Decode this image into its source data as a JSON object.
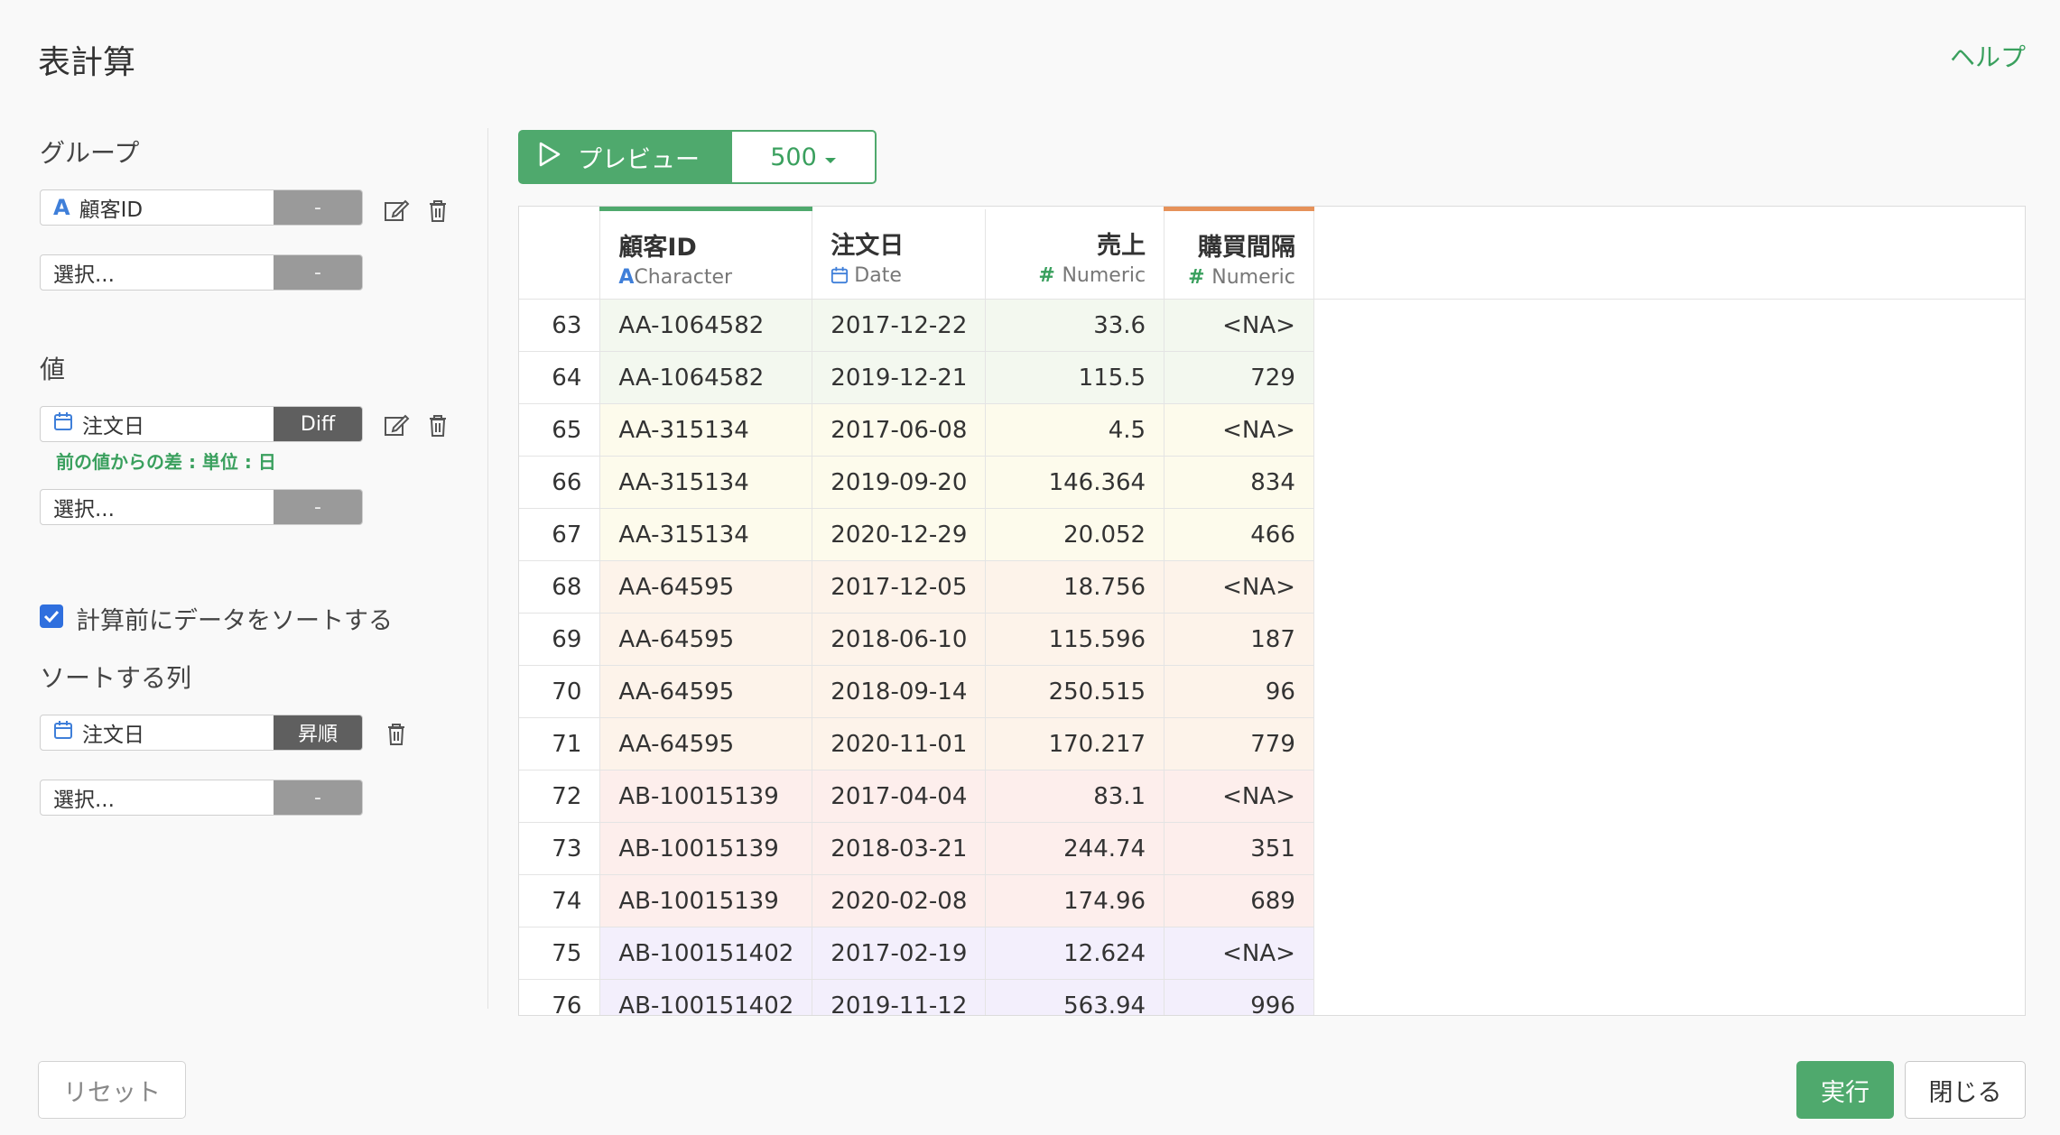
{
  "dialog": {
    "title": "表計算",
    "help_label": "ヘルプ"
  },
  "group": {
    "label": "グループ",
    "fields": [
      {
        "icon": "character-icon",
        "value": "顧客ID",
        "button": "-"
      },
      {
        "icon": "",
        "value": "選択...",
        "button": "-"
      }
    ]
  },
  "value_section": {
    "label": "値",
    "fields": [
      {
        "icon": "calendar-icon",
        "value": "注文日",
        "button": "Diff"
      },
      {
        "icon": "",
        "value": "選択...",
        "button": "-"
      }
    ],
    "hint": "前の値からの差 : 単位 : 日"
  },
  "sort": {
    "checkbox_label": "計算前にデータをソートする",
    "checked": true,
    "label": "ソートする列",
    "fields": [
      {
        "icon": "calendar-icon",
        "value": "注文日",
        "button": "昇順"
      },
      {
        "icon": "",
        "value": "選択...",
        "button": "-"
      }
    ]
  },
  "preview": {
    "button_label": "プレビュー",
    "rows": "500"
  },
  "table": {
    "columns": [
      {
        "name": "顧客ID",
        "type": "Character",
        "type_icon": "A"
      },
      {
        "name": "注文日",
        "type": "Date",
        "type_icon": "calendar"
      },
      {
        "name": "売上",
        "type": "Numeric",
        "type_icon": "#"
      },
      {
        "name": "購買間隔",
        "type": "Numeric",
        "type_icon": "#"
      }
    ],
    "rows": [
      {
        "idx": "63",
        "id": "AA-1064582",
        "date": "2017-12-22",
        "sales": "33.6",
        "interval": "<NA>",
        "color": "#f3f8ef"
      },
      {
        "idx": "64",
        "id": "AA-1064582",
        "date": "2019-12-21",
        "sales": "115.5",
        "interval": "729",
        "color": "#f3f8ef"
      },
      {
        "idx": "65",
        "id": "AA-315134",
        "date": "2017-06-08",
        "sales": "4.5",
        "interval": "<NA>",
        "color": "#fdfbec"
      },
      {
        "idx": "66",
        "id": "AA-315134",
        "date": "2019-09-20",
        "sales": "146.364",
        "interval": "834",
        "color": "#fdfbec"
      },
      {
        "idx": "67",
        "id": "AA-315134",
        "date": "2020-12-29",
        "sales": "20.052",
        "interval": "466",
        "color": "#fdfbec"
      },
      {
        "idx": "68",
        "id": "AA-64595",
        "date": "2017-12-05",
        "sales": "18.756",
        "interval": "<NA>",
        "color": "#fdf3ea"
      },
      {
        "idx": "69",
        "id": "AA-64595",
        "date": "2018-06-10",
        "sales": "115.596",
        "interval": "187",
        "color": "#fdf3ea"
      },
      {
        "idx": "70",
        "id": "AA-64595",
        "date": "2018-09-14",
        "sales": "250.515",
        "interval": "96",
        "color": "#fdf3ea"
      },
      {
        "idx": "71",
        "id": "AA-64595",
        "date": "2020-11-01",
        "sales": "170.217",
        "interval": "779",
        "color": "#fdf3ea"
      },
      {
        "idx": "72",
        "id": "AB-10015139",
        "date": "2017-04-04",
        "sales": "83.1",
        "interval": "<NA>",
        "color": "#fdeeec"
      },
      {
        "idx": "73",
        "id": "AB-10015139",
        "date": "2018-03-21",
        "sales": "244.74",
        "interval": "351",
        "color": "#fdeeec"
      },
      {
        "idx": "74",
        "id": "AB-10015139",
        "date": "2020-02-08",
        "sales": "174.96",
        "interval": "689",
        "color": "#fdeeec"
      },
      {
        "idx": "75",
        "id": "AB-100151402",
        "date": "2017-02-19",
        "sales": "12.624",
        "interval": "<NA>",
        "color": "#f3effc"
      },
      {
        "idx": "76",
        "id": "AB-100151402",
        "date": "2019-11-12",
        "sales": "563.94",
        "interval": "996",
        "color": "#f3effc"
      }
    ]
  },
  "footer": {
    "reset_label": "リセット",
    "run_label": "実行",
    "close_label": "閉じる"
  },
  "colors": {
    "accent": "#4fa96d",
    "char_icon": "#3f7fd9",
    "checkbox": "#2f6fde"
  }
}
